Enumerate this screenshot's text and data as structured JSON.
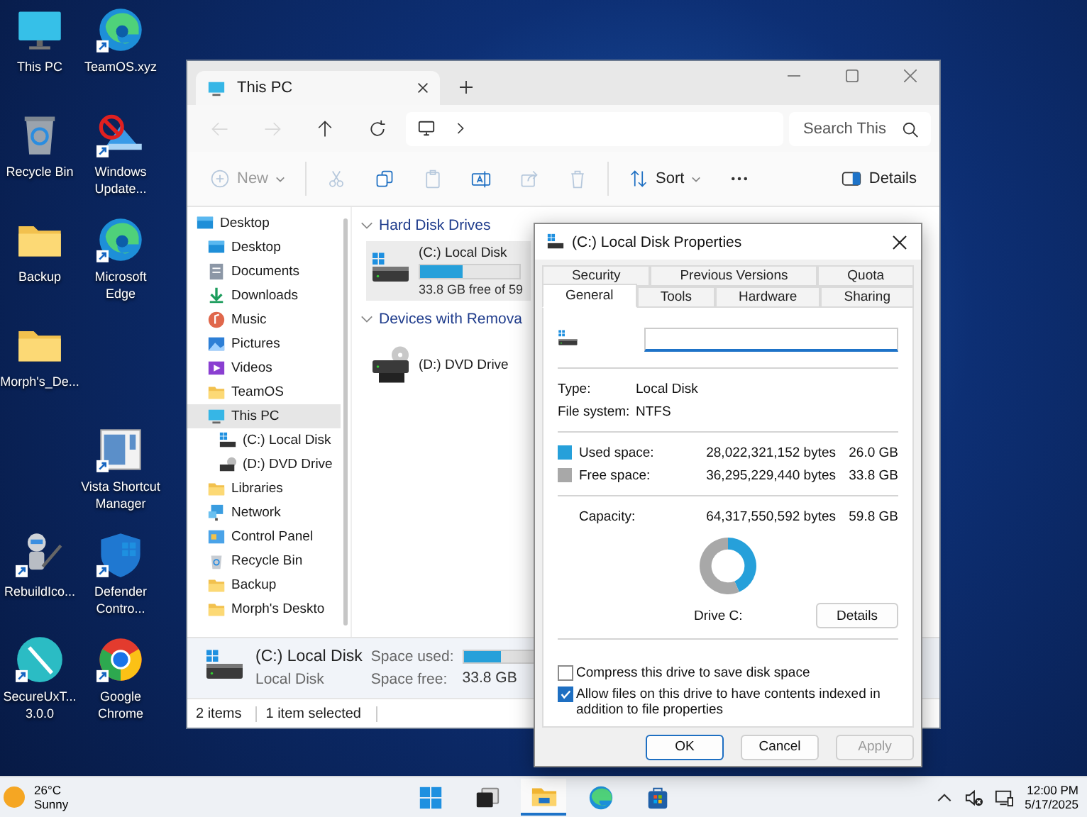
{
  "desktop_icons": [
    {
      "label": "This PC",
      "kind": "monitor",
      "shortcut": false
    },
    {
      "label": "TeamOS.xyz",
      "kind": "edge",
      "shortcut": true
    },
    {
      "label": "Recycle Bin",
      "kind": "recycle",
      "shortcut": false
    },
    {
      "label": "Windows Update...",
      "kind": "update",
      "shortcut": true
    },
    {
      "label": "Backup",
      "kind": "folder",
      "shortcut": false
    },
    {
      "label": "Microsoft Edge",
      "kind": "edge",
      "shortcut": true
    },
    {
      "label": "Morph's_De...",
      "kind": "folder",
      "shortcut": false
    },
    {
      "label": "Vista Shortcut Manager",
      "kind": "app",
      "shortcut": true
    },
    {
      "label": "RebuildIco...",
      "kind": "robot",
      "shortcut": true
    },
    {
      "label": "Defender Contro...",
      "kind": "shield",
      "shortcut": true
    },
    {
      "label": "SecureUxT... 3.0.0",
      "kind": "pen",
      "shortcut": true
    },
    {
      "label": "Google Chrome",
      "kind": "chrome",
      "shortcut": true
    }
  ],
  "explorer": {
    "tab": {
      "title": "This PC"
    },
    "nav": [
      {
        "kind": "back",
        "disabled": true
      },
      {
        "kind": "forward",
        "disabled": true
      },
      {
        "kind": "up",
        "disabled": false
      },
      {
        "kind": "refresh",
        "disabled": false
      }
    ],
    "search": {
      "placeholder": "Search This"
    },
    "toolbar": [
      {
        "kind": "new",
        "label": "New",
        "disabled": true
      },
      {
        "kind": "cut",
        "disabled": true
      },
      {
        "kind": "copy",
        "disabled": false
      },
      {
        "kind": "paste",
        "disabled": true
      },
      {
        "kind": "rename",
        "disabled": false
      },
      {
        "kind": "share",
        "disabled": true
      },
      {
        "kind": "delete",
        "disabled": true
      },
      {
        "kind": "sort",
        "label": "Sort",
        "disabled": false
      },
      {
        "kind": "more",
        "disabled": false
      }
    ],
    "details_button": {
      "label": "Details"
    },
    "sidebar": {
      "items": [
        {
          "label": "Desktop",
          "kind": "desktop",
          "selected": false,
          "children": [
            {
              "label": "Desktop",
              "kind": "desktop",
              "selected": false
            },
            {
              "label": "Documents",
              "kind": "documents",
              "selected": false
            },
            {
              "label": "Downloads",
              "kind": "downloads",
              "selected": false
            },
            {
              "label": "Music",
              "kind": "music",
              "selected": false
            },
            {
              "label": "Pictures",
              "kind": "pictures",
              "selected": false
            },
            {
              "label": "Videos",
              "kind": "videos",
              "selected": false
            },
            {
              "label": "TeamOS",
              "kind": "folder",
              "selected": false
            },
            {
              "label": "This PC",
              "kind": "pc",
              "selected": true,
              "children": [
                {
                  "label": "(C:) Local Disk",
                  "kind": "drive",
                  "selected": false
                },
                {
                  "label": "(D:) DVD Drive",
                  "kind": "dvd",
                  "selected": false
                }
              ]
            },
            {
              "label": "Libraries",
              "kind": "folder",
              "selected": false
            },
            {
              "label": "Network",
              "kind": "network",
              "selected": false
            },
            {
              "label": "Control Panel",
              "kind": "control",
              "selected": false
            },
            {
              "label": "Recycle Bin",
              "kind": "recycle",
              "selected": false
            },
            {
              "label": "Backup",
              "kind": "folder",
              "selected": false
            },
            {
              "label": "Morph's Deskto",
              "kind": "folder",
              "selected": false
            }
          ]
        }
      ]
    },
    "groups": [
      {
        "title": "Hard Disk Drives",
        "expanded": true,
        "items": [
          {
            "name": "(C:) Local Disk",
            "kind": "system-drive",
            "level": 0.435,
            "caption": "33.8 GB free of 59",
            "selected": true
          }
        ]
      },
      {
        "title": "Devices with Remova",
        "expanded": true,
        "items": [
          {
            "name": "(D:) DVD Drive",
            "kind": "dvd",
            "selected": false
          }
        ]
      }
    ],
    "details_pane": {
      "name": "(C:) Local Disk",
      "type": "Local Disk",
      "used_label": "Space used:",
      "level": 0.435,
      "free_label": "Space free:",
      "free_value": "33.8 GB"
    },
    "status_bar": [
      "2 items",
      "1 item selected"
    ]
  },
  "dialog": {
    "title": "(C:) Local Disk Properties",
    "tab_rows": [
      {
        "tabs": [
          {
            "label": "Security",
            "selected": false
          },
          {
            "label": "Previous Versions",
            "selected": false
          },
          {
            "label": "Quota",
            "selected": false
          }
        ]
      },
      {
        "tabs": [
          {
            "label": "General",
            "selected": true
          },
          {
            "label": "Tools",
            "selected": false
          },
          {
            "label": "Hardware",
            "selected": false
          },
          {
            "label": "Sharing",
            "selected": false
          }
        ]
      }
    ],
    "info": [
      {
        "label": "Type:",
        "value": "Local Disk"
      },
      {
        "label": "File system:",
        "value": "NTFS"
      }
    ],
    "space": [
      {
        "label": "Used space:",
        "bytes": "28,022,321,152 bytes",
        "size": "26.0 GB",
        "color": "#26a0da"
      },
      {
        "label": "Free space:",
        "bytes": "36,295,229,440 bytes",
        "size": "33.8 GB",
        "color": "#a8a8a8"
      }
    ],
    "capacity": {
      "label": "Capacity:",
      "bytes": "64,317,550,592 bytes",
      "size": "59.8 GB"
    },
    "usage_ring": {
      "level": 0.435
    },
    "drive_label": "Drive C:",
    "details_button": "Details",
    "options": [
      {
        "label": "Compress this drive to save disk space",
        "checked": false
      },
      {
        "label": "Allow files on this drive to have contents indexed in addition to file properties",
        "checked": true
      }
    ],
    "buttons": [
      {
        "label": "OK",
        "default": true,
        "disabled": false
      },
      {
        "label": "Cancel",
        "default": false,
        "disabled": false
      },
      {
        "label": "Apply",
        "default": false,
        "disabled": true
      }
    ]
  },
  "taskbar": {
    "weather": {
      "temp": "26°C",
      "condition": "Sunny"
    },
    "apps": [
      {
        "kind": "start",
        "active": false
      },
      {
        "kind": "task-view",
        "active": false
      },
      {
        "kind": "explorer",
        "active": true
      },
      {
        "kind": "edge",
        "active": false
      },
      {
        "kind": "store",
        "active": false
      }
    ],
    "clock": {
      "time": "12:00 PM",
      "date": "5/17/2025"
    }
  }
}
